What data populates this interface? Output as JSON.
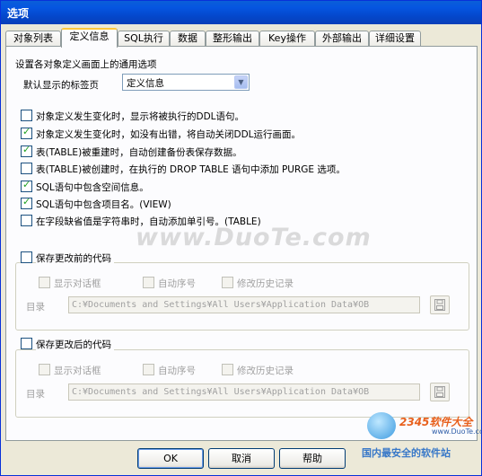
{
  "window": {
    "title": "选项"
  },
  "tabs": [
    {
      "label": "对象列表",
      "active": false
    },
    {
      "label": "定义信息",
      "active": true
    },
    {
      "label": "SQL执行",
      "active": false
    },
    {
      "label": "数据",
      "active": false
    },
    {
      "label": "整形输出",
      "active": false
    },
    {
      "label": "Key操作",
      "active": false
    },
    {
      "label": "外部输出",
      "active": false
    },
    {
      "label": "详细设置",
      "active": false
    }
  ],
  "panel": {
    "heading": "设置各对象定义画面上的通用选项",
    "default_tab_label": "默认显示的标签页",
    "default_tab_value": "定义信息",
    "options": [
      {
        "label": "对象定义发生变化时，显示将被执行的DDL语句。",
        "checked": false
      },
      {
        "label": "对象定义发生变化时，如没有出错，将自动关闭DDL运行画面。",
        "checked": true
      },
      {
        "label": "表(TABLE)被重建时，自动创建备份表保存数据。",
        "checked": true
      },
      {
        "label": "表(TABLE)被创建时，在执行的 DROP TABLE 语句中添加 PURGE 选项。",
        "checked": false
      },
      {
        "label": "SQL语句中包含空间信息。",
        "checked": true
      },
      {
        "label": "SQL语句中包含项目名。(VIEW)",
        "checked": true
      },
      {
        "label": "在字段缺省值是字符串时，自动添加单引号。(TABLE)",
        "checked": false
      }
    ],
    "before_group": {
      "title": "保存更改前的代码",
      "opt_dialog": "显示对话框",
      "opt_autonum": "自动序号",
      "opt_history": "修改历史记录",
      "dir_label": "目录",
      "dir_value": "C:¥Documents and Settings¥All Users¥Application Data¥OB"
    },
    "after_group": {
      "title": "保存更改后的代码",
      "opt_dialog": "显示对话框",
      "opt_autonum": "自动序号",
      "opt_history": "修改历史记录",
      "dir_label": "目录",
      "dir_value": "C:¥Documents and Settings¥All Users¥Application Data¥OB"
    }
  },
  "buttons": {
    "ok": "OK",
    "cancel": "取消",
    "help": "帮助"
  },
  "watermark": "www.DuoTe.com",
  "brand": {
    "logo": "2345软件大全",
    "url": "www.DuoTe.com",
    "slogan": "国内最安全的软件站"
  },
  "colors": {
    "titlebar": "#0555e0",
    "tab_highlight": "#ffc83c",
    "check": "#21a121"
  }
}
